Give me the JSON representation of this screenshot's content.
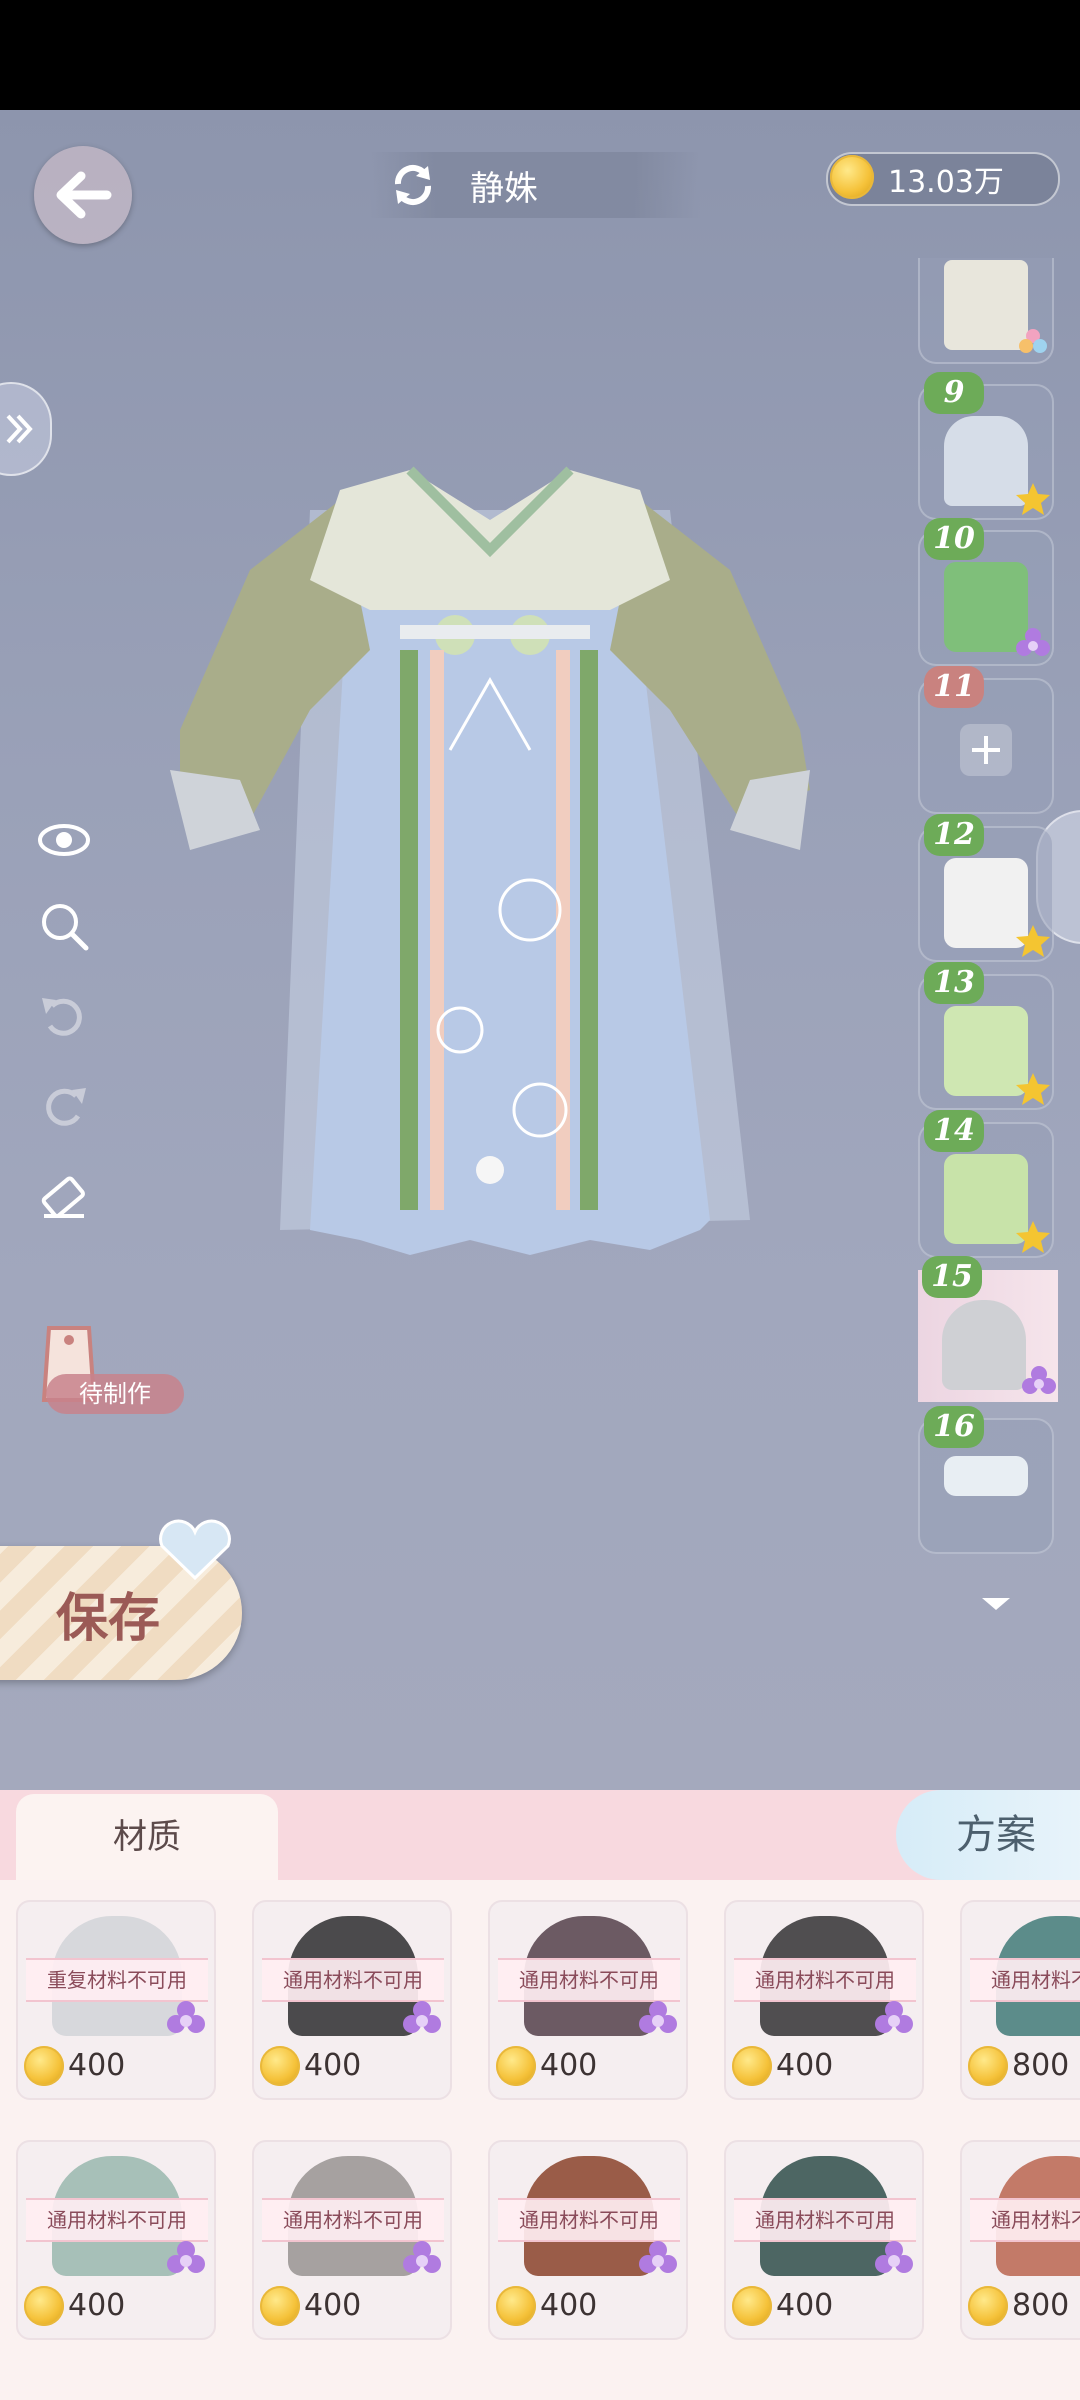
{
  "header": {
    "title": "静姝",
    "coins": "13.03万"
  },
  "left_tools": [
    {
      "name": "eye-icon"
    },
    {
      "name": "zoom-icon"
    },
    {
      "name": "undo-icon"
    },
    {
      "name": "redo-icon"
    },
    {
      "name": "eraser-icon"
    }
  ],
  "pending_tag": "待制作",
  "save_label": "保存",
  "slots": [
    {
      "num": "",
      "badge": "flower-pink"
    },
    {
      "num": "9",
      "badge": "star"
    },
    {
      "num": "10",
      "badge": "flower-purple"
    },
    {
      "num": "11",
      "badge": "plus"
    },
    {
      "num": "12",
      "badge": "star"
    },
    {
      "num": "13",
      "badge": "star"
    },
    {
      "num": "14",
      "badge": "star"
    },
    {
      "num": "15",
      "badge": "flower-purple"
    },
    {
      "num": "16",
      "badge": ""
    }
  ],
  "tabs": {
    "material": "材质",
    "plan": "方案"
  },
  "materials": [
    {
      "label": "重复材料不可用",
      "price": "400",
      "color": "#d7d8dc"
    },
    {
      "label": "通用材料不可用",
      "price": "400",
      "color": "#4b4a4c"
    },
    {
      "label": "通用材料不可用",
      "price": "400",
      "color": "#6c5a63"
    },
    {
      "label": "通用材料不可用",
      "price": "400",
      "color": "#504e50"
    },
    {
      "label": "通用材料不可用",
      "price": "800",
      "color": "#5c8c8a"
    },
    {
      "label": "通用材料不可用",
      "price": "400",
      "color": "#a7c0b8"
    },
    {
      "label": "通用材料不可用",
      "price": "400",
      "color": "#a6a1a0"
    },
    {
      "label": "通用材料不可用",
      "price": "400",
      "color": "#9a5c48"
    },
    {
      "label": "通用材料不可用",
      "price": "400",
      "color": "#4d6663"
    },
    {
      "label": "通用材料不可用",
      "price": "800",
      "color": "#c37a68"
    }
  ]
}
